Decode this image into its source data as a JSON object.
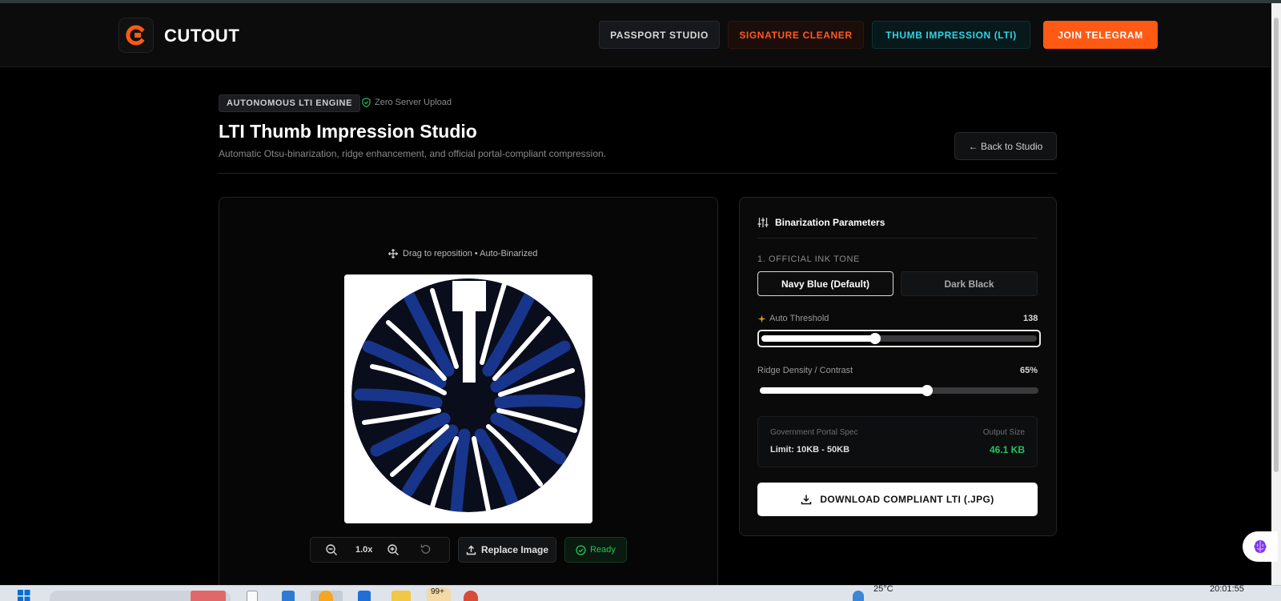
{
  "nav": {
    "brand": "CUTOUT",
    "links": [
      "PASSPORT STUDIO",
      "SIGNATURE CLEANER",
      "THUMB IMPRESSION (LTI)",
      "JOIN TELEGRAM"
    ]
  },
  "header": {
    "badge": "AUTONOMOUS LTI ENGINE",
    "zero_upload": "Zero Server Upload",
    "title": "LTI Thumb Impression Studio",
    "subtitle": "Automatic Otsu-binarization, ridge enhancement, and official portal-compliant compression.",
    "back_label": "← Back to Studio"
  },
  "preview": {
    "drag_hint": "Drag to reposition • Auto-Binarized",
    "zoom_level": "1.0x",
    "replace_label": "Replace Image",
    "status": "Ready"
  },
  "params": {
    "heading": "Binarization Parameters",
    "ink_label": "1. OFFICIAL INK TONE",
    "ink_options": [
      "Navy Blue (Default)",
      "Dark Black"
    ],
    "threshold_label": "Auto Threshold",
    "threshold_value": "138",
    "threshold_fraction": 0.412,
    "ridge_label": "Ridge Density / Contrast",
    "ridge_value": "65%",
    "ridge_fraction": 0.6,
    "spec_label": "Government Portal Spec",
    "spec_limit": "Limit: 10KB - 50KB",
    "output_label": "Output Size",
    "output_value": "46.1 KB",
    "download_label": "DOWNLOAD COMPLIANT LTI (.JPG)"
  },
  "taskbar": {
    "badge": "99+",
    "temperature": "25°C",
    "time": "20:01:55"
  },
  "colors": {
    "accent": "#ff5a14",
    "cyan": "#2fd3e0",
    "success": "#22c55e",
    "ink_navy": "#102a7a"
  }
}
